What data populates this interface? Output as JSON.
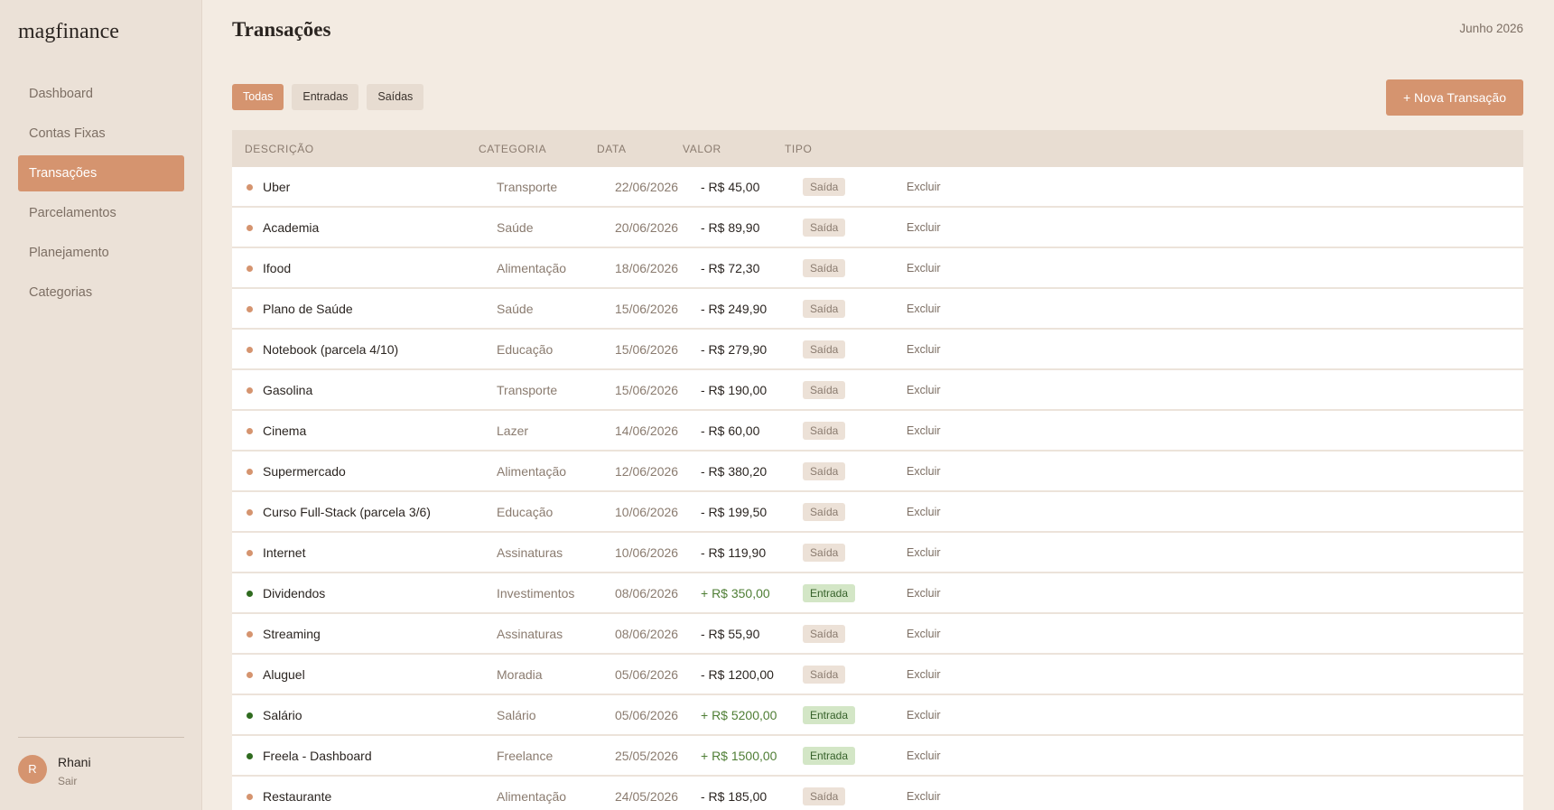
{
  "app": {
    "name": "magfinance"
  },
  "sidebar": {
    "items": [
      {
        "label": "Dashboard",
        "active": false
      },
      {
        "label": "Contas Fixas",
        "active": false
      },
      {
        "label": "Transações",
        "active": true
      },
      {
        "label": "Parcelamentos",
        "active": false
      },
      {
        "label": "Planejamento",
        "active": false
      },
      {
        "label": "Categorias",
        "active": false
      }
    ],
    "user": {
      "initial": "R",
      "name": "Rhani",
      "logout": "Sair"
    }
  },
  "header": {
    "title": "Transações",
    "period": "Junho 2026"
  },
  "filters": [
    {
      "label": "Todas",
      "active": true
    },
    {
      "label": "Entradas",
      "active": false
    },
    {
      "label": "Saídas",
      "active": false
    }
  ],
  "actions": {
    "new_transaction": "+ Nova Transação"
  },
  "table": {
    "columns": [
      "Descrição",
      "Categoria",
      "Data",
      "Valor",
      "Tipo"
    ],
    "delete_label": "Excluir",
    "rows": [
      {
        "description": "Uber",
        "category": "Transporte",
        "date": "22/06/2026",
        "value": "- R$ 45,00",
        "type": "Saída",
        "kind": "out"
      },
      {
        "description": "Academia",
        "category": "Saúde",
        "date": "20/06/2026",
        "value": "- R$ 89,90",
        "type": "Saída",
        "kind": "out"
      },
      {
        "description": "Ifood",
        "category": "Alimentação",
        "date": "18/06/2026",
        "value": "- R$ 72,30",
        "type": "Saída",
        "kind": "out"
      },
      {
        "description": "Plano de Saúde",
        "category": "Saúde",
        "date": "15/06/2026",
        "value": "- R$ 249,90",
        "type": "Saída",
        "kind": "out"
      },
      {
        "description": "Notebook (parcela 4/10)",
        "category": "Educação",
        "date": "15/06/2026",
        "value": "- R$ 279,90",
        "type": "Saída",
        "kind": "out"
      },
      {
        "description": "Gasolina",
        "category": "Transporte",
        "date": "15/06/2026",
        "value": "- R$ 190,00",
        "type": "Saída",
        "kind": "out"
      },
      {
        "description": "Cinema",
        "category": "Lazer",
        "date": "14/06/2026",
        "value": "- R$ 60,00",
        "type": "Saída",
        "kind": "out"
      },
      {
        "description": "Supermercado",
        "category": "Alimentação",
        "date": "12/06/2026",
        "value": "- R$ 380,20",
        "type": "Saída",
        "kind": "out"
      },
      {
        "description": "Curso Full-Stack (parcela 3/6)",
        "category": "Educação",
        "date": "10/06/2026",
        "value": "- R$ 199,50",
        "type": "Saída",
        "kind": "out"
      },
      {
        "description": "Internet",
        "category": "Assinaturas",
        "date": "10/06/2026",
        "value": "- R$ 119,90",
        "type": "Saída",
        "kind": "out"
      },
      {
        "description": "Dividendos",
        "category": "Investimentos",
        "date": "08/06/2026",
        "value": "+ R$ 350,00",
        "type": "Entrada",
        "kind": "in"
      },
      {
        "description": "Streaming",
        "category": "Assinaturas",
        "date": "08/06/2026",
        "value": "- R$ 55,90",
        "type": "Saída",
        "kind": "out"
      },
      {
        "description": "Aluguel",
        "category": "Moradia",
        "date": "05/06/2026",
        "value": "- R$ 1200,00",
        "type": "Saída",
        "kind": "out"
      },
      {
        "description": "Salário",
        "category": "Salário",
        "date": "05/06/2026",
        "value": "+ R$ 5200,00",
        "type": "Entrada",
        "kind": "in"
      },
      {
        "description": "Freela - Dashboard",
        "category": "Freelance",
        "date": "25/05/2026",
        "value": "+ R$ 1500,00",
        "type": "Entrada",
        "kind": "in"
      },
      {
        "description": "Restaurante",
        "category": "Alimentação",
        "date": "24/05/2026",
        "value": "- R$ 185,00",
        "type": "Saída",
        "kind": "out"
      }
    ]
  }
}
